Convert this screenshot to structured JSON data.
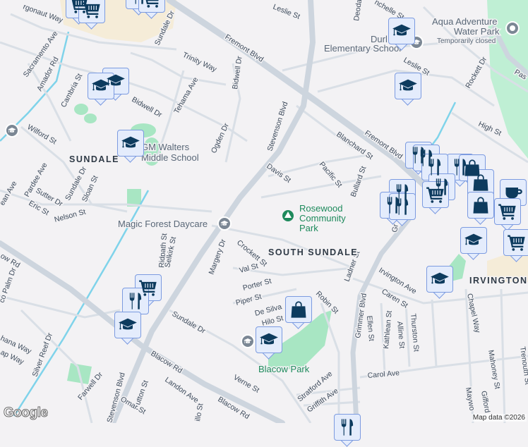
{
  "map": {
    "colors": {
      "background": "#f3f2f4",
      "major_road": "#cdd5de",
      "minor_road": "#d9dfe6",
      "park": "#a8e6c3",
      "commercial": "#f5ecd8",
      "water": "#7fd3ea",
      "marker_fill": "#e4ecfc",
      "marker_border": "#7c9be0",
      "icon": "#0d3b5e"
    },
    "streets": [
      "rgonaut Way",
      "Sacramento Ave",
      "Amador Rd",
      "Cambria St",
      "Sundale Dr",
      "Trinity Way",
      "Tehama Ave",
      "Bidwell Dr",
      "Bidwell Dr",
      "Ogden Dr",
      "Wilford St",
      "Pardee Ave",
      "Sundale Dr",
      "Sutter Dr",
      "Sloan St",
      "Eric St",
      "ean Ave",
      "Nelson St",
      "Ridpath St",
      "Selkirk St",
      "Margery Dr",
      "Crockett St",
      "Val St",
      "Porter St",
      "Piper St",
      "De Silva",
      "Hilo St",
      "Sundale Dr",
      "ow Rd",
      "Blacow Rd",
      "Blacow Rd",
      "Silver Reef Dr",
      "co Palm Dr",
      "hana Way",
      "ap Way",
      "Stevenson Blvd",
      "Farwell Dr",
      "Hutton St",
      "Landon Ave",
      "Omar St",
      "illo St",
      "Verne St",
      "Stevenson Blvd",
      "Leslie St",
      "Leslie St",
      "Deodar",
      "nchelle St",
      "Rockett Dr",
      "High St",
      "Fremont Blvd",
      "Fremont Blvd",
      "Blanchard St",
      "Davis St",
      "Pacific St",
      "Bullard St",
      "Ladner St",
      "Robin St",
      "Grimmer Blvd",
      "Irvington Ave",
      "Caren St",
      "Ellen St",
      "Kathlean St",
      "Alline St",
      "Thurston St",
      "Chapel Way",
      "Mahoney St",
      "Trenouth St",
      "Carol Ave",
      "Stratford Ave",
      "Griffith Ave",
      "Maywo",
      "Gifford",
      "Pas",
      "Gr"
    ],
    "areas": [
      "SUNDALE",
      "SOUTH SUNDALE",
      "IRVINGTON"
    ],
    "places": {
      "gm_walters": [
        "GM Walters",
        "Middle School"
      ],
      "durham": [
        "Durl",
        "Elementary School"
      ],
      "aqua": [
        "Aqua Adventure",
        "Water Park",
        "Temporarily closed"
      ],
      "magic_forest": "Magic Forest Daycare",
      "rosewood": [
        "Rosewood",
        "Community",
        "Park"
      ],
      "blacow_park": "Blacow Park"
    },
    "markers": [
      "cart",
      "cart",
      "restaurant",
      "cart",
      "school",
      "school",
      "school",
      "school",
      "school",
      "school",
      "school",
      "school",
      "bag",
      "restaurant",
      "restaurant",
      "restaurant",
      "restaurant",
      "bag",
      "bag",
      "restaurant",
      "restaurant",
      "cart",
      "restaurant",
      "restaurant",
      "coffee",
      "bag",
      "cart",
      "cart",
      "cart",
      "restaurant",
      "school",
      "restaurant"
    ],
    "attribution": "Map data ©2026",
    "logo": "Google"
  }
}
